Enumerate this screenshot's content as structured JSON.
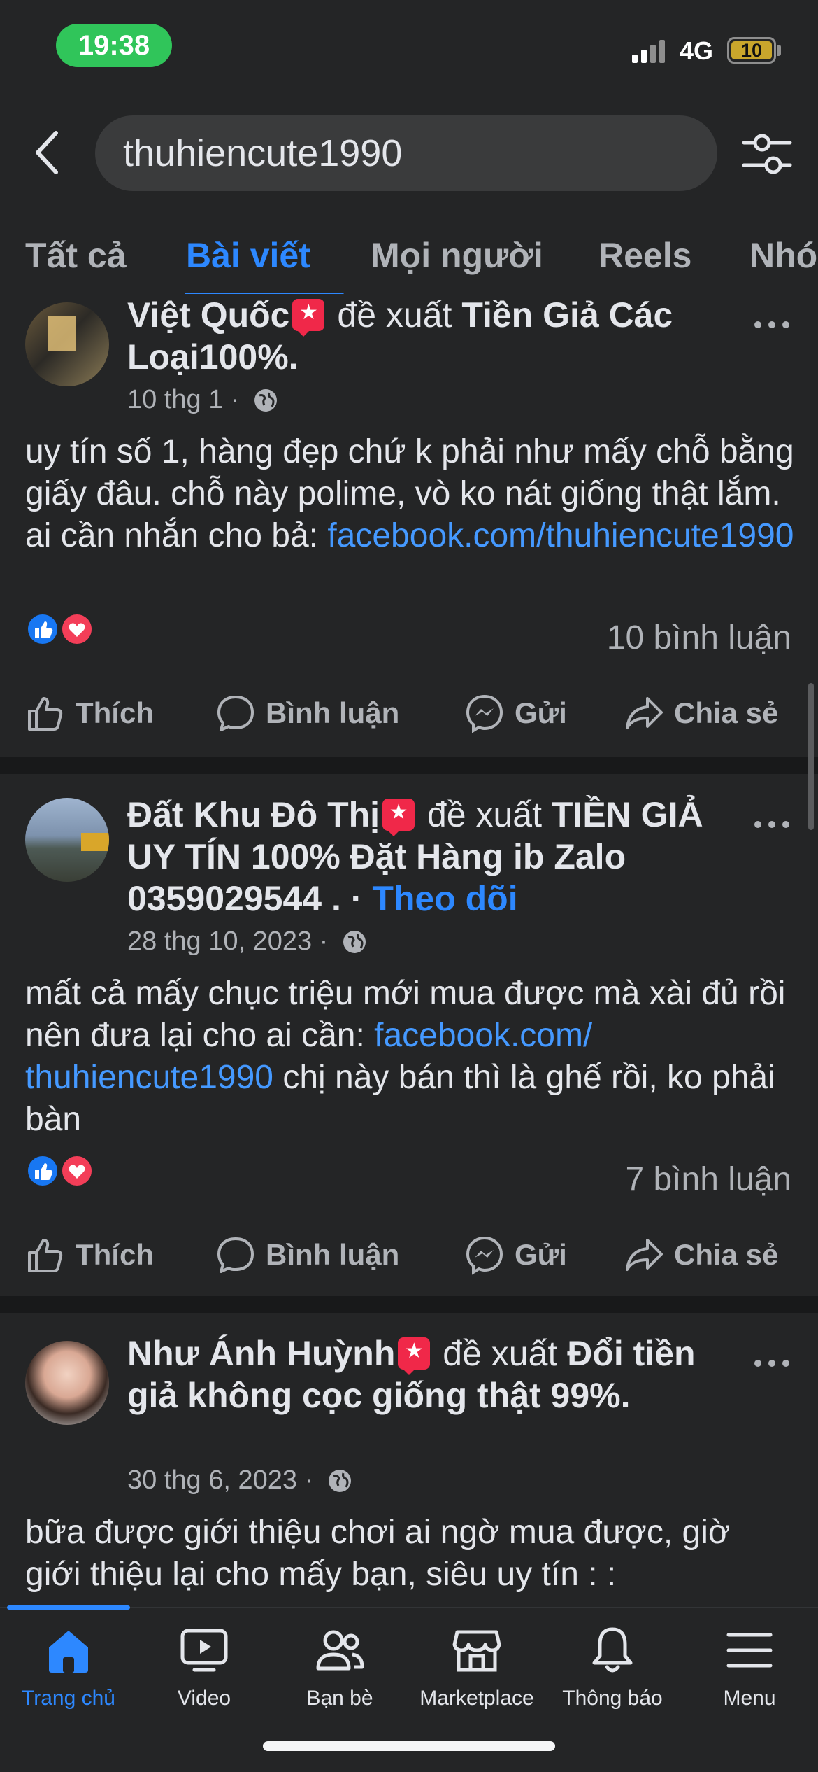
{
  "status_bar": {
    "time": "19:38",
    "network": "4G",
    "battery": "10"
  },
  "search": {
    "query": "thuhiencute1990"
  },
  "tabs": [
    {
      "label": "Tất cả"
    },
    {
      "label": "Bài viết"
    },
    {
      "label": "Mọi người"
    },
    {
      "label": "Reels"
    },
    {
      "label": "Nhó"
    }
  ],
  "posts": [
    {
      "author": "Việt Quốc",
      "suggest_word": "đề xuất",
      "topic": "Tiền Giả Các Loại100%.",
      "date": "10 thg 1 ·",
      "text": "uy tín số 1, hàng đẹp chứ k phải như mấy chỗ bằng giấy đâu. chỗ này polime, vò ko nát giống thật lắm. ai cần nhắn cho bả: ",
      "link": "facebook.com/thuhiencute1990",
      "text_after": "",
      "comments": "10 bình luận"
    },
    {
      "author": "Đất Khu Đô Thị",
      "suggest_word": "đề xuất",
      "topic": "TIỀN GIẢ UY TÍN 100% Đặt Hàng ib Zalo 0359029544 . ·",
      "follow": "Theo dõi",
      "date": "28 thg 10, 2023 ·",
      "text": "mất cả mấy chục triệu mới mua được mà xài đủ rồi nên đưa lại cho ai cần: ",
      "link": "facebook.com/ thuhiencute1990",
      "text_after": " chị này bán thì là ghế rồi, ko phải bàn",
      "comments": "7 bình luận"
    },
    {
      "author": "Như Ánh Huỳnh",
      "suggest_word": "đề xuất",
      "topic": "Đổi tiền giả không cọc giống thật 99%.",
      "date": "30 thg 6, 2023 ·",
      "text": "bữa được giới thiệu chơi ai ngờ mua được, giờ giới thiệu lại cho mấy bạn, siêu uy tín : :",
      "link": "",
      "text_after": "",
      "comments": ""
    }
  ],
  "actions": {
    "like": "Thích",
    "comment": "Bình luận",
    "send": "Gửi",
    "share": "Chia sẻ"
  },
  "bottom_nav": [
    {
      "label": "Trang chủ",
      "icon": "home-icon"
    },
    {
      "label": "Video",
      "icon": "video-icon"
    },
    {
      "label": "Bạn bè",
      "icon": "friends-icon"
    },
    {
      "label": "Marketplace",
      "icon": "marketplace-icon"
    },
    {
      "label": "Thông báo",
      "icon": "bell-icon"
    },
    {
      "label": "Menu",
      "icon": "menu-icon"
    }
  ],
  "colors": {
    "background": "#242526",
    "accent": "#2d88ff",
    "link": "#4599ff",
    "time_pill": "#30c55a"
  }
}
